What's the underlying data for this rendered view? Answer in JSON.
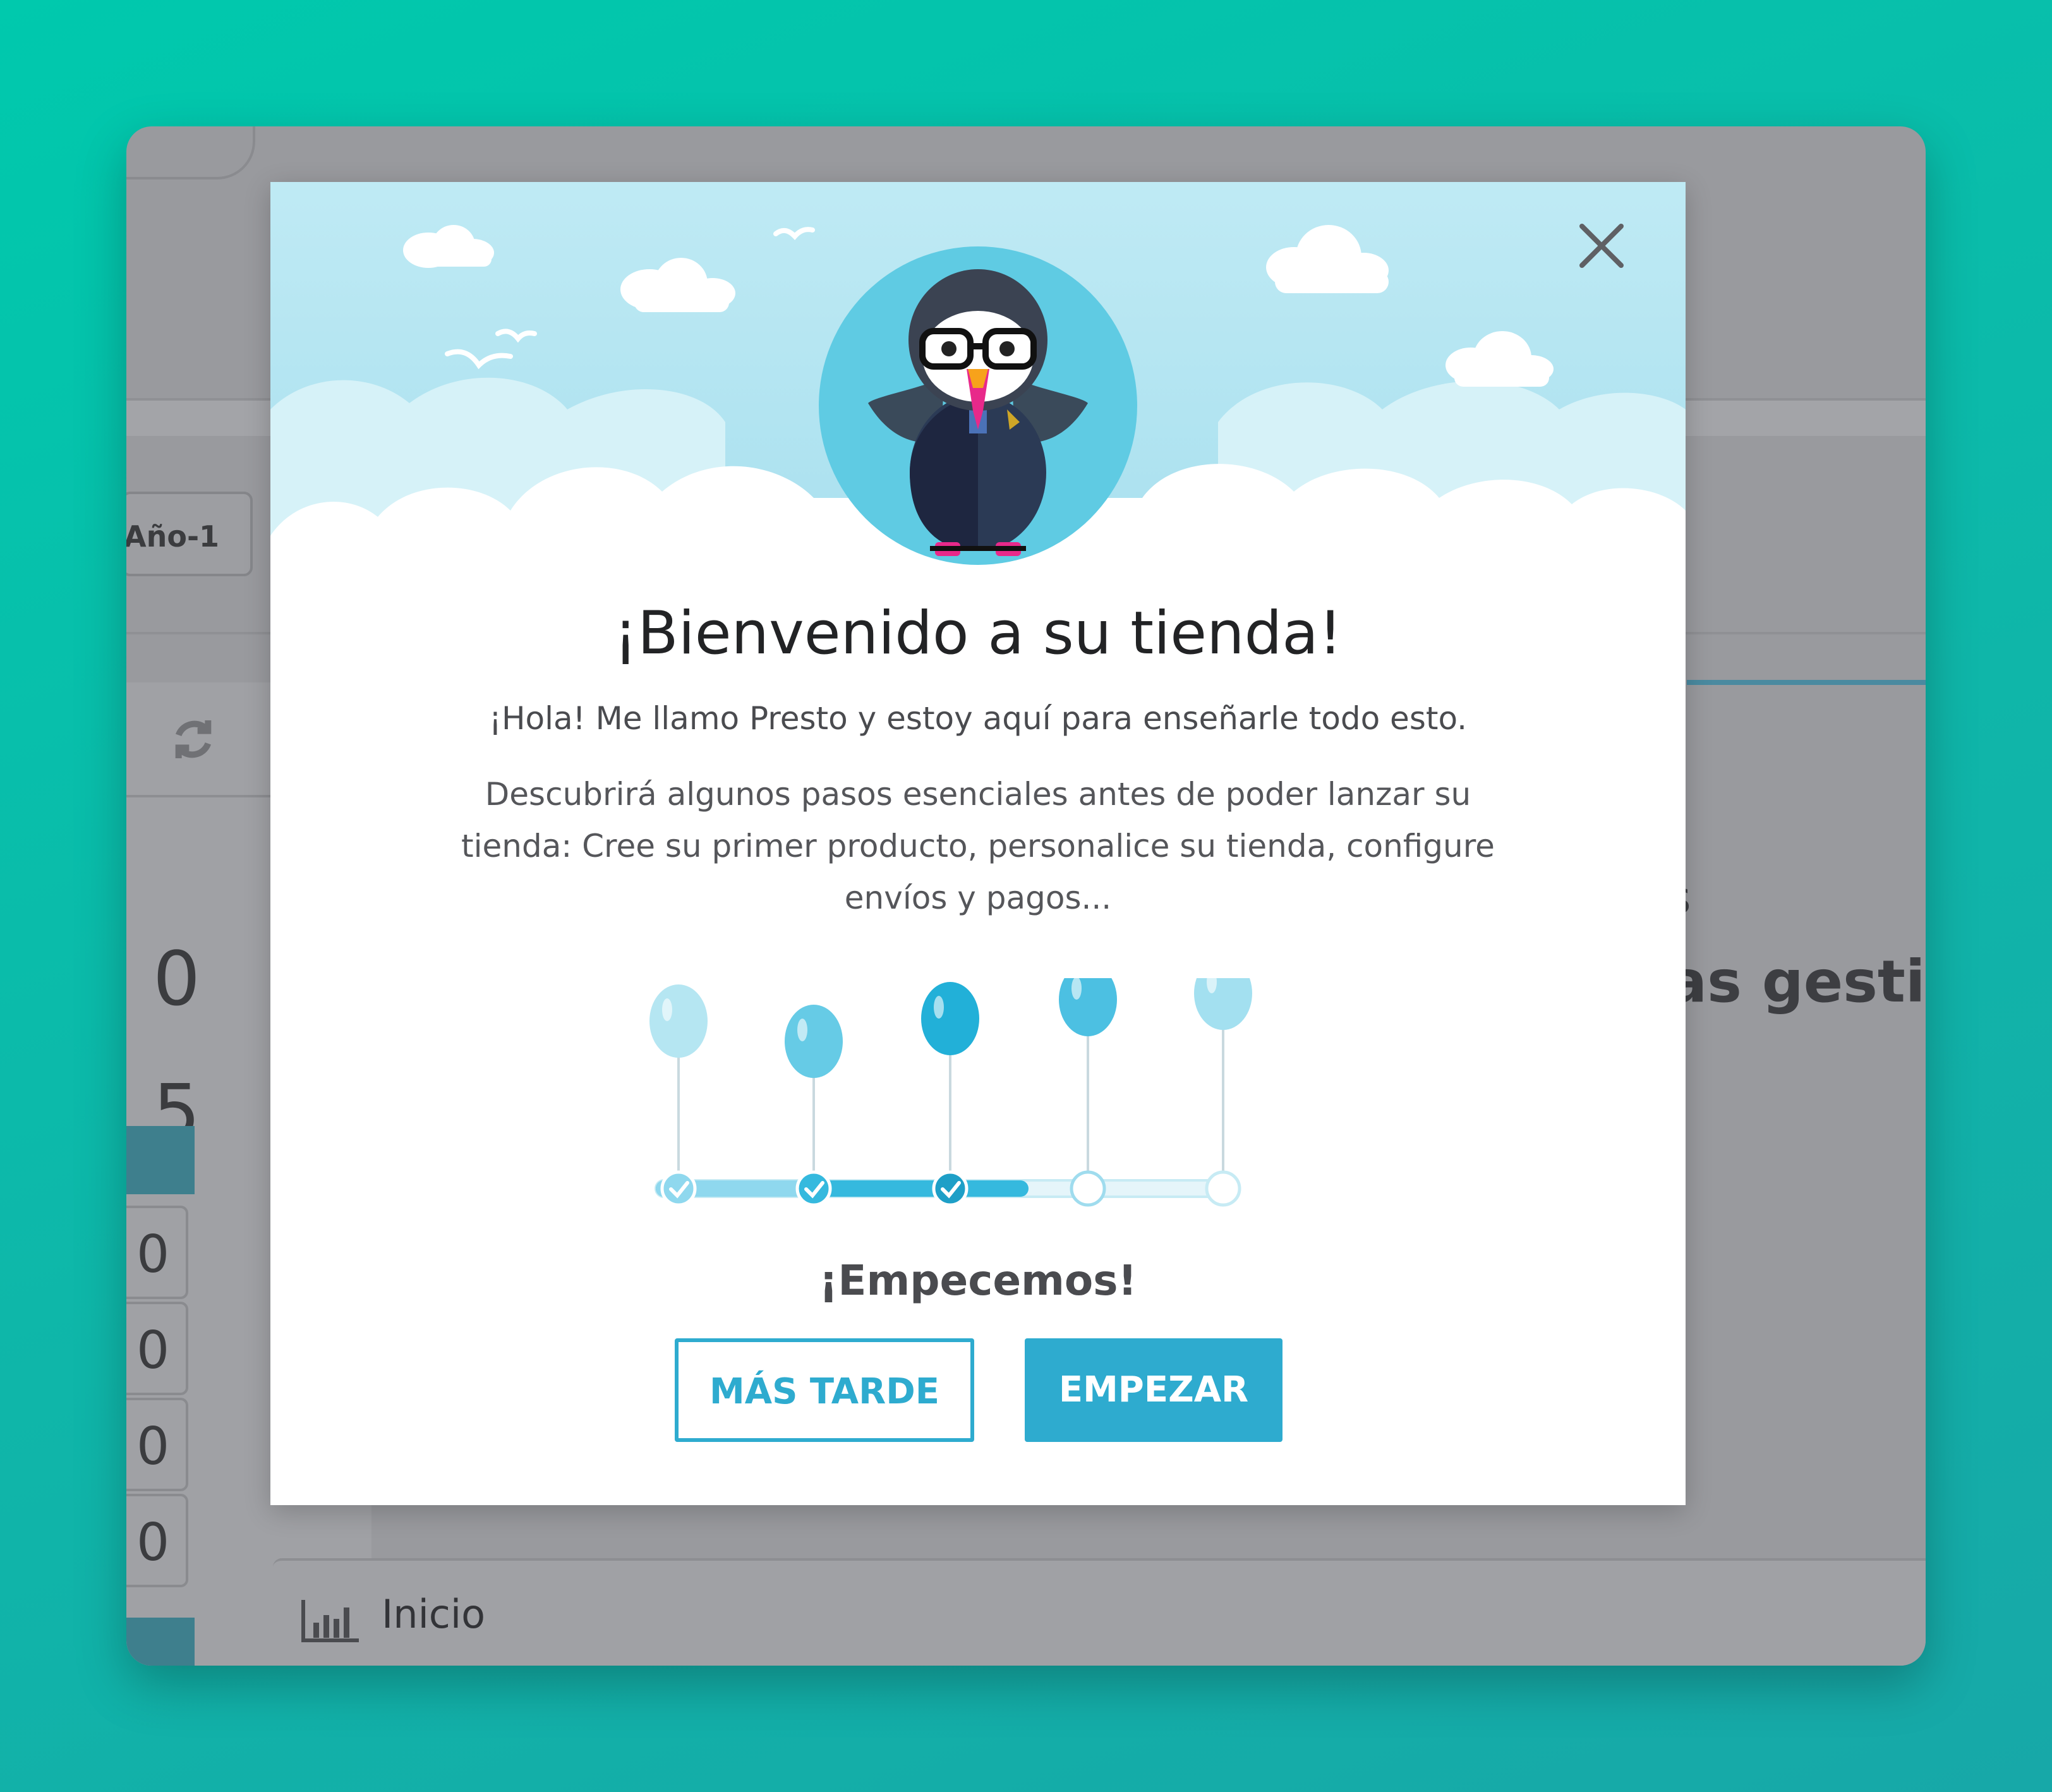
{
  "background": {
    "year_filter": "Año-1",
    "kpi_values": [
      "0",
      "5"
    ],
    "table_values": [
      "0",
      "0",
      "0",
      "0"
    ],
    "partial_heading": "as gestion",
    "partial_letter": "s",
    "bottom_section": {
      "label": "Inicio",
      "icon": "bar-chart-icon"
    }
  },
  "modal": {
    "title": "¡Bienvenido a su tienda!",
    "subtitle": "¡Hola! Me llamo Presto y estoy aquí para enseñarle todo esto.",
    "description": "Descubrirá algunos pasos esenciales antes de poder lanzar su tienda: Cree su primer producto, personalice su tienda, configure envíos y pagos...",
    "call_to_action": "¡Empecemos!",
    "buttons": {
      "later": "MÁS TARDE",
      "start": "EMPEZAR"
    },
    "close_icon": "close-icon",
    "progress": {
      "total_steps": 5,
      "completed_steps": 3
    },
    "colors": {
      "accent": "#2eabcf",
      "sky": "#c9eef6",
      "mascot_circle": "#5fcbe3"
    }
  }
}
